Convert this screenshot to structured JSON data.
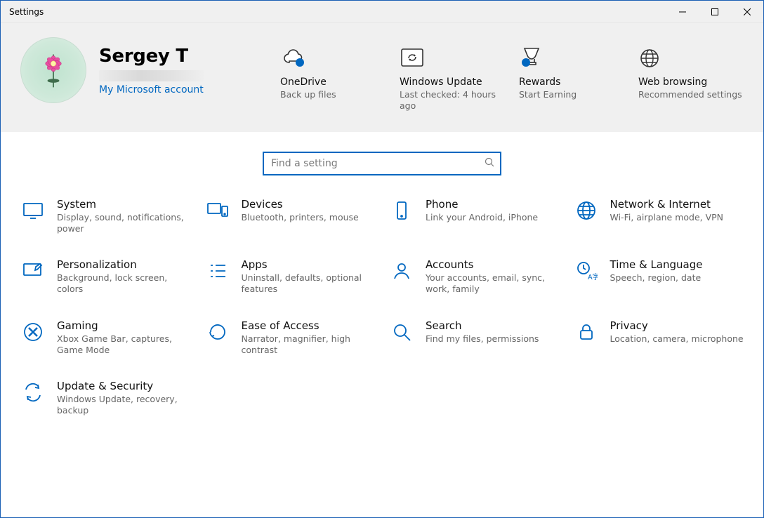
{
  "window": {
    "title": "Settings"
  },
  "profile": {
    "name": "Sergey T",
    "account_link": "My Microsoft account"
  },
  "banner": {
    "onedrive": {
      "title": "OneDrive",
      "sub": "Back up files"
    },
    "update": {
      "title": "Windows Update",
      "sub": "Last checked: 4 hours ago"
    },
    "rewards": {
      "title": "Rewards",
      "sub": "Start Earning"
    },
    "browsing": {
      "title": "Web browsing",
      "sub": "Recommended settings"
    }
  },
  "search": {
    "placeholder": "Find a setting"
  },
  "categories": {
    "system": {
      "title": "System",
      "sub": "Display, sound, notifications, power"
    },
    "devices": {
      "title": "Devices",
      "sub": "Bluetooth, printers, mouse"
    },
    "phone": {
      "title": "Phone",
      "sub": "Link your Android, iPhone"
    },
    "network": {
      "title": "Network & Internet",
      "sub": "Wi-Fi, airplane mode, VPN"
    },
    "personalization": {
      "title": "Personalization",
      "sub": "Background, lock screen, colors"
    },
    "apps": {
      "title": "Apps",
      "sub": "Uninstall, defaults, optional features"
    },
    "accounts": {
      "title": "Accounts",
      "sub": "Your accounts, email, sync, work, family"
    },
    "time": {
      "title": "Time & Language",
      "sub": "Speech, region, date"
    },
    "gaming": {
      "title": "Gaming",
      "sub": "Xbox Game Bar, captures, Game Mode"
    },
    "ease": {
      "title": "Ease of Access",
      "sub": "Narrator, magnifier, high contrast"
    },
    "searchCat": {
      "title": "Search",
      "sub": "Find my files, permissions"
    },
    "privacy": {
      "title": "Privacy",
      "sub": "Location, camera, microphone"
    },
    "updatesec": {
      "title": "Update & Security",
      "sub": "Windows Update, recovery, backup"
    }
  }
}
